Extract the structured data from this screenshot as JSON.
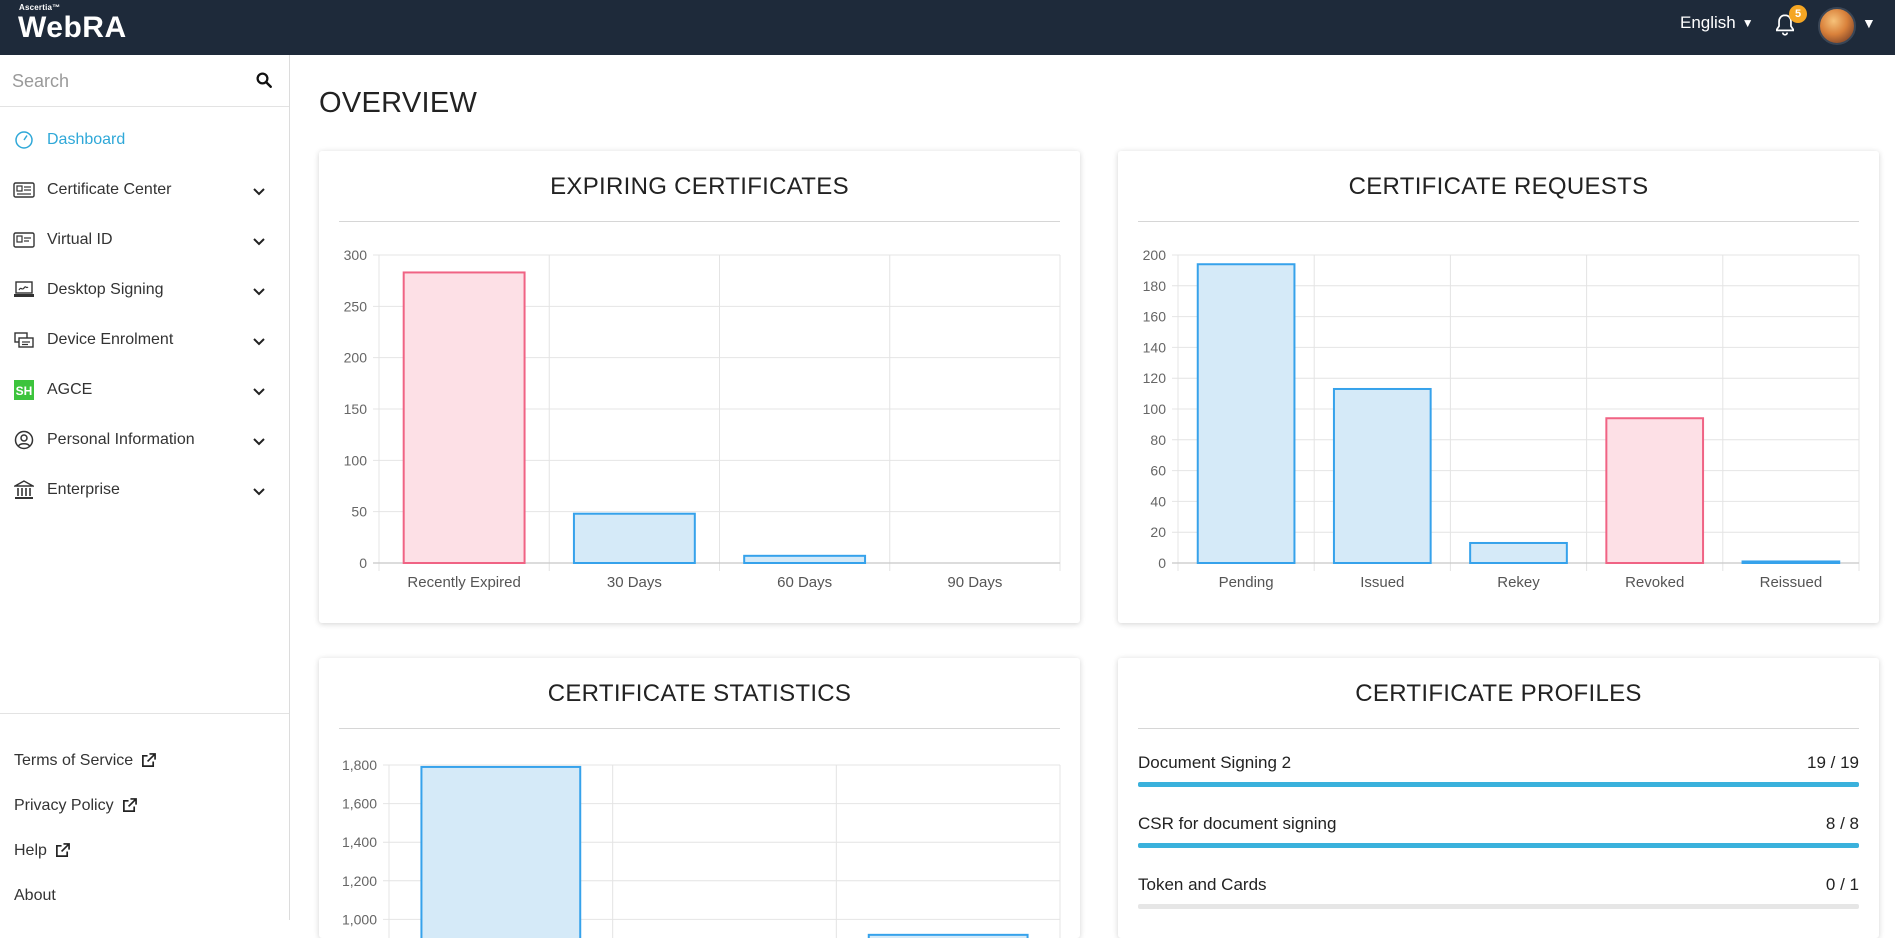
{
  "header": {
    "brand_small": "Ascertia™",
    "brand": "WebRA",
    "language": "English",
    "notification_count": "5"
  },
  "sidebar": {
    "search_placeholder": "Search",
    "items": [
      {
        "label": "Dashboard",
        "icon": "dashboard-gauge-icon",
        "active": true
      },
      {
        "label": "Certificate Center",
        "icon": "certificate-card-icon"
      },
      {
        "label": "Virtual ID",
        "icon": "virtual-id-card-icon"
      },
      {
        "label": "Desktop Signing",
        "icon": "desktop-signing-icon"
      },
      {
        "label": "Device Enrolment",
        "icon": "device-enrolment-icon"
      },
      {
        "label": "AGCE",
        "icon": "agce-sh-icon"
      },
      {
        "label": "Personal Information",
        "icon": "user-circle-icon"
      },
      {
        "label": "Enterprise",
        "icon": "bank-building-icon"
      }
    ],
    "footer": [
      {
        "label": "Terms of Service",
        "external": true
      },
      {
        "label": "Privacy Policy",
        "external": true
      },
      {
        "label": "Help",
        "external": true
      },
      {
        "label": "About",
        "external": false
      }
    ]
  },
  "main": {
    "title": "OVERVIEW",
    "cards": {
      "expiring": {
        "title": "EXPIRING CERTIFICATES"
      },
      "requests": {
        "title": "CERTIFICATE REQUESTS"
      },
      "statistics": {
        "title": "CERTIFICATE STATISTICS"
      },
      "profiles": {
        "title": "CERTIFICATE PROFILES"
      }
    },
    "profiles": [
      {
        "name": "Document Signing 2",
        "count": "19 / 19",
        "fraction": 1.0
      },
      {
        "name": "CSR for document signing",
        "count": "8 / 8",
        "fraction": 1.0
      },
      {
        "name": "Token and Cards",
        "count": "0 / 1",
        "fraction": 0.0
      }
    ]
  },
  "colors": {
    "blue_stroke": "#36a2eb",
    "blue_fill": "#d5eaf8",
    "red_stroke": "#f06384",
    "red_fill": "#fde0e6",
    "accent": "#2fa8d8",
    "header_bg": "#1e2a3a"
  },
  "chart_data": [
    {
      "type": "bar",
      "categories": [
        "Recently Expired",
        "30 Days",
        "60 Days",
        "90 Days"
      ],
      "values": [
        283,
        48,
        7,
        0
      ],
      "bar_colors": [
        "red",
        "blue",
        "blue",
        "blue"
      ],
      "yticks": [
        "0",
        "50",
        "100",
        "150",
        "200",
        "250",
        "300"
      ],
      "ylim": [
        0,
        300
      ],
      "grid": true
    },
    {
      "type": "bar",
      "categories": [
        "Pending",
        "Issued",
        "Rekey",
        "Revoked",
        "Reissued"
      ],
      "values": [
        194,
        113,
        13,
        94,
        1
      ],
      "bar_colors": [
        "blue",
        "blue",
        "blue",
        "red",
        "blue"
      ],
      "yticks": [
        "0",
        "20",
        "40",
        "60",
        "80",
        "100",
        "120",
        "140",
        "160",
        "180",
        "200"
      ],
      "ylim": [
        0,
        200
      ],
      "grid": true
    },
    {
      "type": "bar",
      "categories": [
        "",
        "",
        ""
      ],
      "values": [
        1790,
        0,
        920
      ],
      "bar_colors": [
        "blue",
        "blue",
        "blue"
      ],
      "yticks": [
        "1,000",
        "1,200",
        "1,400",
        "1,600",
        "1,800"
      ],
      "ylim": [
        0,
        1800
      ],
      "grid": true
    }
  ]
}
